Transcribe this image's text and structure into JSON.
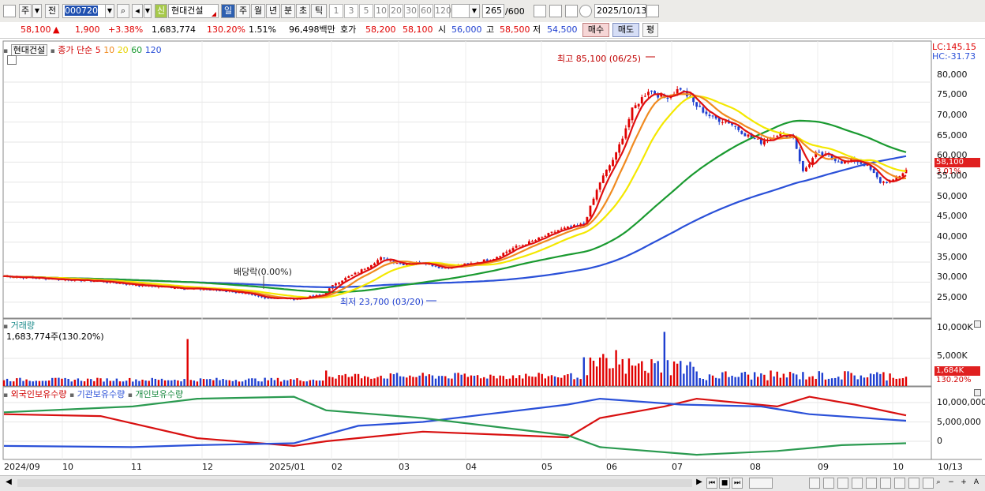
{
  "toolbar": {
    "market": "주",
    "prev": "전",
    "code": "000720",
    "badge": "신",
    "name": "현대건설",
    "periods": [
      "일",
      "주",
      "월",
      "년",
      "분",
      "초",
      "틱"
    ],
    "intervals": [
      "1",
      "3",
      "5",
      "10",
      "20",
      "30",
      "60",
      "120"
    ],
    "count": "265",
    "count_total": "/600",
    "date": "2025/10/13"
  },
  "quote": {
    "price": "58,100",
    "arrow": "▲",
    "change": "1,900",
    "pct": "+3.38%",
    "volume": "1,683,774",
    "vol_ratio": "130.20%",
    "turnover": "1.51%",
    "amount": "96,498백만",
    "ask_label": "호가",
    "ask": "58,200",
    "bid": "58,100",
    "open_label": "시",
    "open": "56,000",
    "high_label": "고",
    "high": "58,500",
    "low_label": "저",
    "low": "54,500",
    "buy": "매수",
    "sell": "매도",
    "avg": "평"
  },
  "legend": {
    "name": "현대건설",
    "type": "종가 단순",
    "ma": [
      "5",
      "10",
      "20",
      "60",
      "120"
    ]
  },
  "annotations": {
    "lc": "LC:145.15",
    "hc": "HC:-31.73",
    "high": "최고 85,100 (06/25)",
    "low": "최저 23,700 (03/20)",
    "div": "배당락(0.00%)",
    "price_tag": "58,100",
    "pct_tag": "3.01%"
  },
  "volume_panel": {
    "title": "거래량",
    "value": "1,683,774주(130.20%)",
    "tag": "1,684K",
    "tag_pct": "130.20%",
    "ticks": [
      "10,000K",
      "5,000K",
      "0"
    ]
  },
  "holdings_panel": {
    "series": [
      "외국인보유수량",
      "기관보유수량",
      "개인보유수량"
    ],
    "ticks": [
      "10,000,000",
      "5,000,000",
      "0"
    ]
  },
  "colors": {
    "up": "#e00000",
    "down": "#1f3fd0",
    "ma5": "#e01010",
    "ma10": "#f08a20",
    "ma20": "#f4e800",
    "ma60": "#1a9a30",
    "ma120": "#2a50d8"
  },
  "chart_data": {
    "type": "candlestick",
    "x_labels": [
      "2024/09",
      "10",
      "11",
      "12",
      "2025/01",
      "02",
      "03",
      "04",
      "05",
      "06",
      "07",
      "08",
      "09",
      "10",
      "10/13"
    ],
    "y_ticks": [
      "80,000",
      "75,000",
      "70,000",
      "65,000",
      "60,000",
      "55,000",
      "50,000",
      "45,000",
      "40,000",
      "35,000",
      "30,000",
      "25,000"
    ],
    "ylim": [
      21000,
      87500
    ],
    "close_series": {
      "name": "종가",
      "points": [
        [
          0,
          31500
        ],
        [
          15,
          30800
        ],
        [
          30,
          30200
        ],
        [
          45,
          29000
        ],
        [
          60,
          28300
        ],
        [
          70,
          27800
        ],
        [
          80,
          26200
        ],
        [
          90,
          25800
        ],
        [
          99,
          26800
        ],
        [
          103,
          29800
        ],
        [
          110,
          32500
        ],
        [
          117,
          36000
        ],
        [
          124,
          34500
        ],
        [
          130,
          35000
        ],
        [
          136,
          33500
        ],
        [
          140,
          34000
        ],
        [
          146,
          34800
        ],
        [
          152,
          36000
        ],
        [
          158,
          38500
        ],
        [
          165,
          40500
        ],
        [
          172,
          43000
        ],
        [
          180,
          44500
        ],
        [
          185,
          55000
        ],
        [
          190,
          62000
        ],
        [
          195,
          73000
        ],
        [
          200,
          78000
        ],
        [
          205,
          76000
        ],
        [
          210,
          78500
        ],
        [
          215,
          74000
        ],
        [
          220,
          71000
        ],
        [
          225,
          70000
        ],
        [
          230,
          67000
        ],
        [
          235,
          65000
        ],
        [
          240,
          67000
        ],
        [
          245,
          66500
        ],
        [
          248,
          57500
        ],
        [
          252,
          62000
        ],
        [
          256,
          61500
        ],
        [
          260,
          60000
        ],
        [
          264,
          60500
        ],
        [
          268,
          59000
        ],
        [
          272,
          55000
        ],
        [
          276,
          55200
        ],
        [
          280,
          58100
        ]
      ]
    },
    "volume": {
      "name": "거래량",
      "spikes": [
        [
          57,
          8500
        ],
        [
          100,
          2800
        ],
        [
          186,
          5800
        ],
        [
          190,
          6500
        ],
        [
          205,
          9800
        ]
      ]
    },
    "holdings": {
      "foreign": [
        [
          0,
          7000000
        ],
        [
          30,
          6500000
        ],
        [
          60,
          800000
        ],
        [
          90,
          -1200000
        ],
        [
          100,
          0
        ],
        [
          130,
          2500000
        ],
        [
          160,
          1500000
        ],
        [
          175,
          1000000
        ],
        [
          185,
          6000000
        ],
        [
          205,
          9000000
        ],
        [
          215,
          11000000
        ],
        [
          240,
          9000000
        ],
        [
          250,
          11500000
        ],
        [
          264,
          9500000
        ],
        [
          280,
          6700000
        ]
      ],
      "institution": [
        [
          0,
          -1200000
        ],
        [
          40,
          -1500000
        ],
        [
          60,
          -1000000
        ],
        [
          90,
          -500000
        ],
        [
          110,
          4000000
        ],
        [
          130,
          5000000
        ],
        [
          150,
          7000000
        ],
        [
          175,
          9500000
        ],
        [
          185,
          11000000
        ],
        [
          210,
          9500000
        ],
        [
          235,
          9000000
        ],
        [
          250,
          7000000
        ],
        [
          280,
          5300000
        ]
      ],
      "individual": [
        [
          0,
          7500000
        ],
        [
          40,
          9000000
        ],
        [
          60,
          11000000
        ],
        [
          90,
          11500000
        ],
        [
          100,
          8000000
        ],
        [
          130,
          6000000
        ],
        [
          150,
          4000000
        ],
        [
          175,
          1500000
        ],
        [
          185,
          -1500000
        ],
        [
          215,
          -3500000
        ],
        [
          240,
          -2500000
        ],
        [
          260,
          -1000000
        ],
        [
          280,
          -500000
        ]
      ]
    },
    "grid": true
  }
}
